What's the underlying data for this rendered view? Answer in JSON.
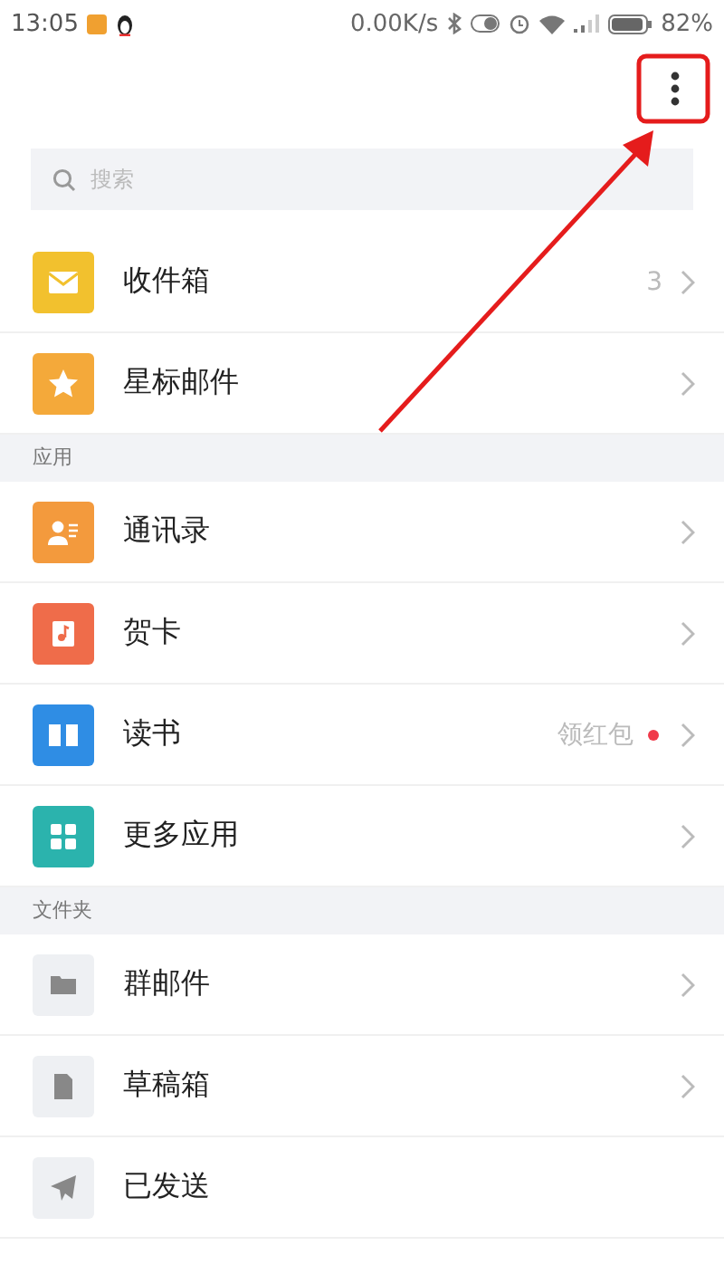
{
  "status_bar": {
    "time": "13:05",
    "net_speed": "0.00K/s",
    "battery": "82%"
  },
  "search": {
    "placeholder": "搜索"
  },
  "sections": [
    {
      "items": [
        {
          "kind": "envelope",
          "color": "#f2c12e",
          "label": "收件箱",
          "count": "3",
          "chevron": true
        },
        {
          "kind": "star",
          "color": "#f4a93a",
          "label": "星标邮件",
          "chevron": true
        }
      ]
    },
    {
      "title": "应用",
      "items": [
        {
          "kind": "contact",
          "color": "#f39a3d",
          "label": "通讯录",
          "chevron": true
        },
        {
          "kind": "card",
          "color": "#ef6c4a",
          "label": "贺卡",
          "chevron": true
        },
        {
          "kind": "book",
          "color": "#2f8de4",
          "label": "读书",
          "note": "领红包",
          "dot": true,
          "chevron": true
        },
        {
          "kind": "grid",
          "color": "#2bb3ad",
          "label": "更多应用",
          "chevron": true
        }
      ]
    },
    {
      "title": "文件夹",
      "items": [
        {
          "kind": "folder",
          "label": "群邮件",
          "chevron": true
        },
        {
          "kind": "draft",
          "label": "草稿箱",
          "chevron": true
        },
        {
          "kind": "send",
          "label": "已发送",
          "chevron": false
        }
      ]
    }
  ],
  "annotation": {
    "kind": "arrow"
  }
}
